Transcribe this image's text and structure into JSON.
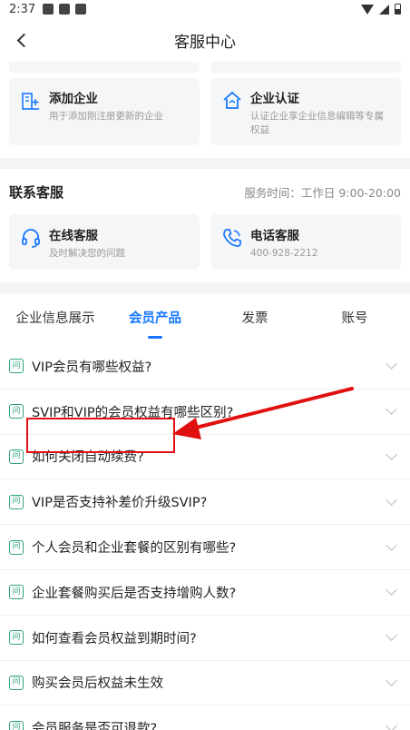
{
  "status": {
    "time": "2:37"
  },
  "nav": {
    "title": "客服中心"
  },
  "enterprise": {
    "cards": [
      {
        "title": "添加企业",
        "desc": "用于添加刚注册更新的企业"
      },
      {
        "title": "企业认证",
        "desc": "认证企业享企业信息编辑等专属权益"
      }
    ]
  },
  "contact": {
    "heading": "联系客服",
    "service_time": "服务时间：工作日 9:00-20:00",
    "cards": [
      {
        "title": "在线客服",
        "desc": "及时解决您的问题"
      },
      {
        "title": "电话客服",
        "desc": "400-928-2212"
      }
    ]
  },
  "tabs": [
    "企业信息展示",
    "会员产品",
    "发票",
    "账号"
  ],
  "faq_icon": "问",
  "questions": [
    "VIP会员有哪些权益?",
    "SVIP和VIP的会员权益有哪些区别?",
    "如何关闭自动续费?",
    "VIP是否支持补差价升级SVIP?",
    "个人会员和企业套餐的区别有哪些?",
    "企业套餐购买后是否支持增购人数?",
    "如何查看会员权益到期时间?",
    "购买会员后权益未生效",
    "会员服务是否可退款?"
  ],
  "colors": {
    "accent": "#1677ff",
    "faq_icon": "#2fa37a",
    "annotation": "#e01010"
  }
}
